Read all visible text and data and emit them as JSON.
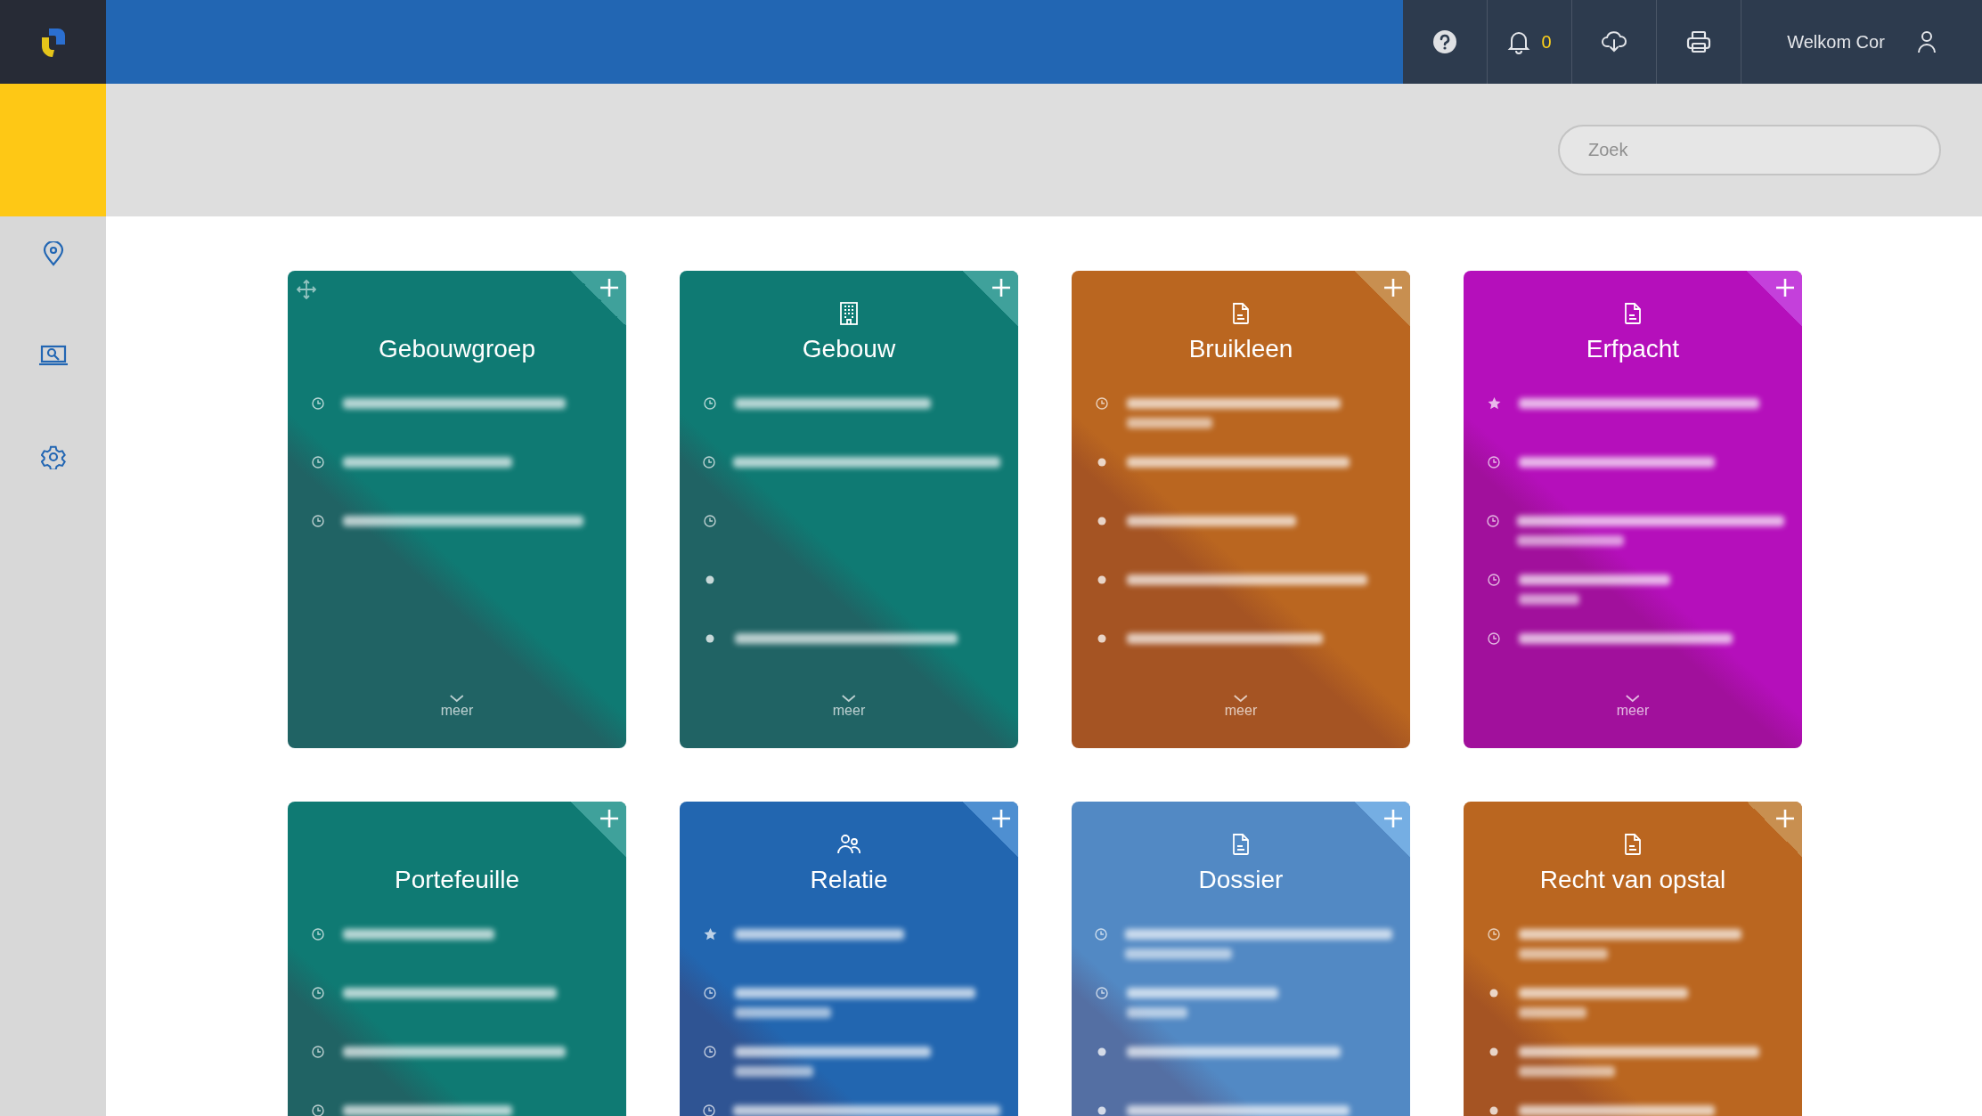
{
  "topbar": {
    "notifications": "0",
    "welcome": "Welkom Cor"
  },
  "search": {
    "placeholder": "Zoek"
  },
  "sidebar": {
    "items": [
      {
        "kind": "pin"
      },
      {
        "kind": "laptop"
      },
      {
        "kind": "gear"
      }
    ]
  },
  "cards": [
    {
      "title": "Gebouwgroep",
      "kind": "group",
      "color": "#0f7a73",
      "more": "meer",
      "items": [
        {
          "kind": "clock",
          "two_line": false,
          "empty": false
        },
        {
          "kind": "clock",
          "two_line": false,
          "empty": false
        },
        {
          "kind": "clock",
          "two_line": false,
          "empty": false
        }
      ]
    },
    {
      "title": "Gebouw",
      "kind": "building",
      "color": "#0f7a73",
      "more": "meer",
      "items": [
        {
          "kind": "clock",
          "two_line": false,
          "empty": false
        },
        {
          "kind": "clock",
          "two_line": false,
          "empty": false
        },
        {
          "kind": "clock",
          "empty": true
        },
        {
          "kind": "dot",
          "empty": true
        },
        {
          "kind": "dot",
          "two_line": false,
          "empty": false
        }
      ]
    },
    {
      "title": "Bruikleen",
      "kind": "document",
      "color": "#ba6620",
      "more": "meer",
      "items": [
        {
          "kind": "clock",
          "two_line": true,
          "empty": false
        },
        {
          "kind": "dot",
          "two_line": false,
          "empty": false
        },
        {
          "kind": "dot",
          "two_line": false,
          "empty": false
        },
        {
          "kind": "dot",
          "two_line": false,
          "empty": false
        },
        {
          "kind": "dot",
          "two_line": false,
          "empty": false
        }
      ]
    },
    {
      "title": "Erfpacht",
      "kind": "document",
      "color": "#b50fbb",
      "more": "meer",
      "items": [
        {
          "kind": "star",
          "two_line": false,
          "empty": false
        },
        {
          "kind": "clock",
          "two_line": false,
          "empty": false
        },
        {
          "kind": "clock",
          "two_line": true,
          "empty": false
        },
        {
          "kind": "clock",
          "two_line": true,
          "empty": false
        },
        {
          "kind": "clock",
          "two_line": false,
          "empty": false
        }
      ]
    },
    {
      "title": "Portefeuille",
      "kind": "plain",
      "color": "#0f7a73",
      "items": [
        {
          "kind": "clock",
          "two_line": false,
          "empty": false
        },
        {
          "kind": "clock",
          "two_line": false,
          "empty": false
        },
        {
          "kind": "clock",
          "two_line": false,
          "empty": false
        },
        {
          "kind": "clock",
          "empty": false
        }
      ]
    },
    {
      "title": "Relatie",
      "kind": "people",
      "color": "#2266b0",
      "items": [
        {
          "kind": "star",
          "two_line": false,
          "empty": false
        },
        {
          "kind": "clock",
          "two_line": true,
          "empty": false
        },
        {
          "kind": "clock",
          "two_line": true,
          "empty": false
        },
        {
          "kind": "clock",
          "empty": false
        }
      ]
    },
    {
      "title": "Dossier",
      "kind": "document",
      "color": "#5289c4",
      "items": [
        {
          "kind": "clock",
          "two_line": true,
          "empty": false
        },
        {
          "kind": "clock",
          "two_line": true,
          "empty": false
        },
        {
          "kind": "dot",
          "two_line": false,
          "empty": false
        },
        {
          "kind": "dot",
          "empty": false
        }
      ]
    },
    {
      "title": "Recht van opstal",
      "kind": "document",
      "color": "#ba6620",
      "items": [
        {
          "kind": "clock",
          "two_line": true,
          "empty": false
        },
        {
          "kind": "dot",
          "two_line": true,
          "empty": false
        },
        {
          "kind": "dot",
          "two_line": true,
          "empty": false
        },
        {
          "kind": "dot",
          "empty": false
        }
      ]
    }
  ]
}
